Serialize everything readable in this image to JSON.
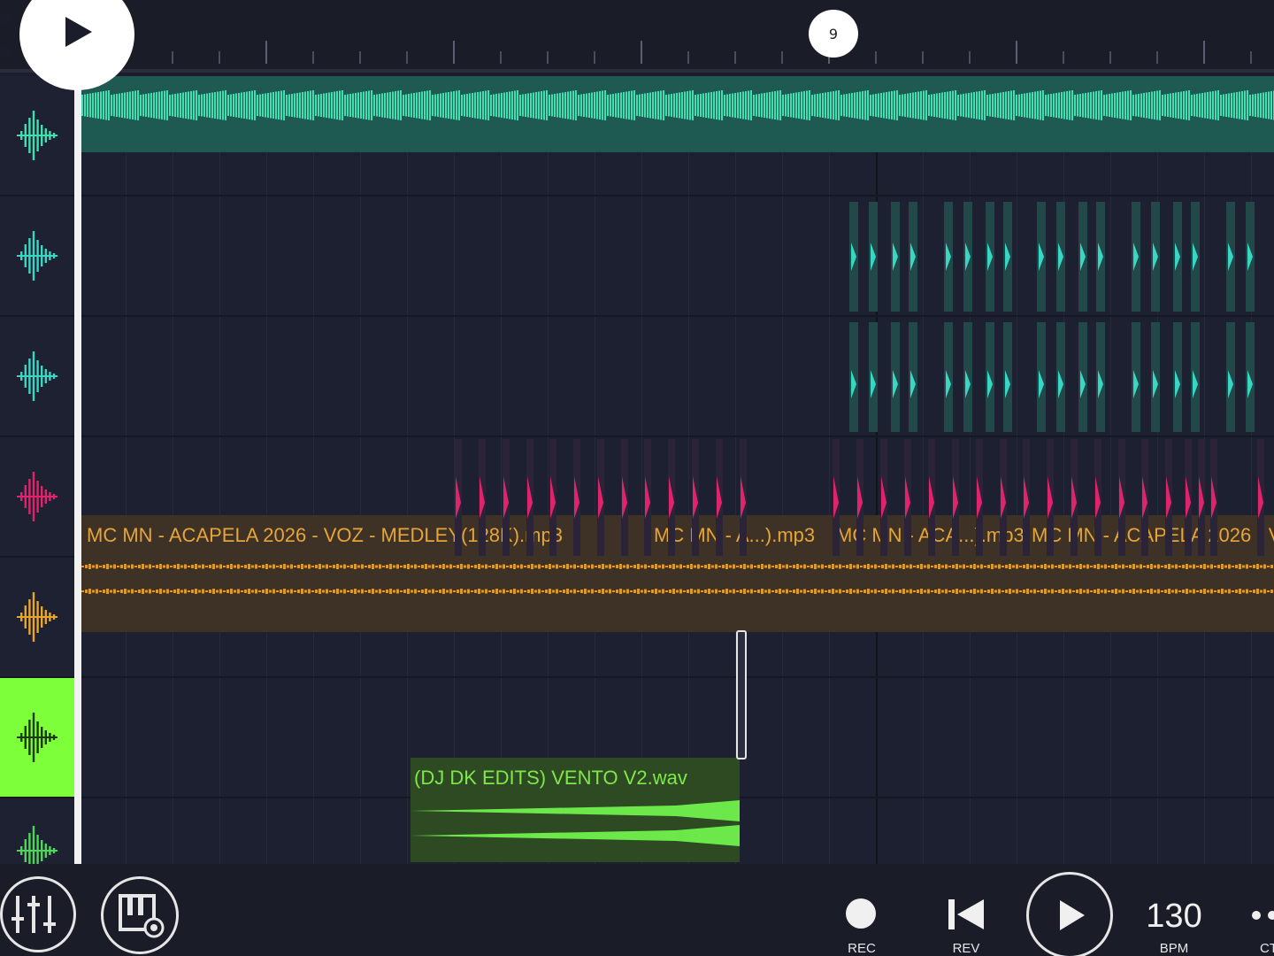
{
  "timeline": {
    "bar_marker": "9"
  },
  "tracks": [
    {
      "id": "track-1",
      "color": "#3ee0b0"
    },
    {
      "id": "track-2",
      "color": "#3ad6c4"
    },
    {
      "id": "track-3",
      "color": "#3ad6c4"
    },
    {
      "id": "track-4",
      "color": "#e0246c"
    },
    {
      "id": "track-5",
      "color": "#e8a52a"
    },
    {
      "id": "track-6",
      "color": "#3ad6a0",
      "selected": true
    },
    {
      "id": "track-7",
      "color": "#4fd65a"
    }
  ],
  "clips": {
    "acapela": [
      "MC MN - ACAPELA 2026 - VOZ - MEDLEY(128K).mp3",
      "MC MN - A...).mp3",
      "MC MN - ACA...).mp3",
      "MC MN - ACAPELA 2026 - V"
    ],
    "vento": "(DJ DK EDITS) VENTO V2.wav"
  },
  "toolbar": {
    "rec_label": "REC",
    "rev_label": "REV",
    "bpm_value": "130",
    "bpm_label": "BPM",
    "ct_label": "CT"
  },
  "icons": {
    "mixer": "mixer-sliders-icon",
    "piano": "piano-settings-icon",
    "play": "play-icon",
    "rec": "record-dot-icon",
    "rev": "rewind-icon",
    "more": "more-dots-icon"
  }
}
